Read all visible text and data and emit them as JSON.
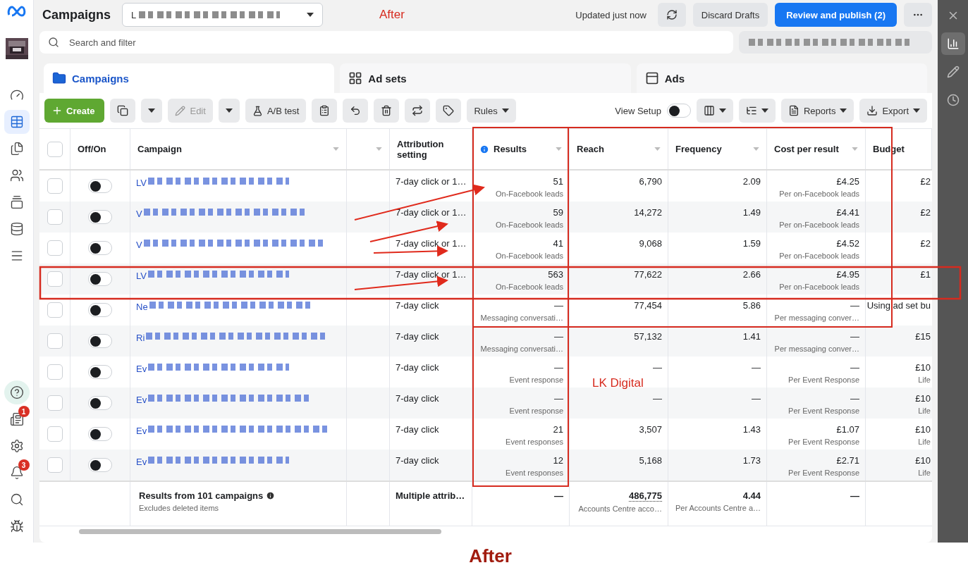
{
  "header": {
    "title": "Campaigns",
    "account_selector": {
      "value": "L"
    },
    "status": "Updated just now",
    "actions": [
      {
        "label": "Discard Drafts",
        "kind": "secondary"
      },
      {
        "label": "Review and publish (2)",
        "kind": "primary"
      }
    ]
  },
  "search": {
    "placeholder": "Search and filter"
  },
  "tabs": [
    {
      "label": "Campaigns",
      "kind": "campaigns",
      "selected": true
    },
    {
      "label": "Ad sets",
      "kind": "adsets",
      "selected": false
    },
    {
      "label": "Ads",
      "kind": "ads",
      "selected": false
    }
  ],
  "toolbar": {
    "create": "Create",
    "edit": {
      "label": "Edit",
      "disabled": true
    },
    "ab_test": "A/B test",
    "rules": "Rules",
    "view_setup": {
      "label": "View Setup",
      "on": false
    },
    "reports": "Reports",
    "export": "Export"
  },
  "sidebar": {
    "top": [
      {
        "kind": "dashboard",
        "selected": false
      },
      {
        "kind": "campaigns",
        "selected": true
      },
      {
        "kind": "pages",
        "selected": false
      },
      {
        "kind": "audiences",
        "selected": false
      },
      {
        "kind": "catalog",
        "selected": false
      },
      {
        "kind": "billing",
        "selected": false
      },
      {
        "kind": "menu",
        "selected": false
      }
    ],
    "bottom": [
      {
        "kind": "help",
        "selected": false
      },
      {
        "kind": "news",
        "selected": false,
        "badge": "1"
      },
      {
        "kind": "settings",
        "selected": false
      },
      {
        "kind": "notifications",
        "selected": false,
        "badge": "3"
      },
      {
        "kind": "search",
        "selected": false
      },
      {
        "kind": "debug",
        "selected": false
      }
    ]
  },
  "side_panel": [
    {
      "kind": "close",
      "selected": false
    },
    {
      "kind": "insights",
      "selected": true
    },
    {
      "kind": "edit",
      "selected": false
    },
    {
      "kind": "history",
      "selected": false
    }
  ],
  "table": {
    "select_all": {
      "checked": false
    },
    "columns": [
      {
        "label": "Off/On",
        "sortable": false,
        "info": false
      },
      {
        "label": "Campaign",
        "sortable": true,
        "info": false
      },
      {
        "label": "Attribution setting",
        "sortable": false,
        "info": false
      },
      {
        "label": "Results",
        "sortable": true,
        "info": true
      },
      {
        "label": "Reach",
        "sortable": true,
        "info": false
      },
      {
        "label": "Frequency",
        "sortable": true,
        "info": false
      },
      {
        "label": "Cost per result",
        "sortable": true,
        "info": false
      },
      {
        "label": "Budget",
        "sortable": false,
        "info": false
      }
    ],
    "rows": [
      {
        "checked": false,
        "on": false,
        "campaign": "LV",
        "attribution": "7-day click or 1…",
        "results": "51",
        "results_type": "On-Facebook leads",
        "reach": "6,790",
        "frequency": "2.09",
        "cost": "£4.25",
        "cost_type": "Per on-Facebook leads",
        "budget": "£2"
      },
      {
        "checked": false,
        "on": false,
        "campaign": "V",
        "attribution": "7-day click or 1…",
        "results": "59",
        "results_type": "On-Facebook leads",
        "reach": "14,272",
        "frequency": "1.49",
        "cost": "£4.41",
        "cost_type": "Per on-Facebook leads",
        "budget": "£2"
      },
      {
        "checked": false,
        "on": false,
        "campaign": "V",
        "attribution": "7-day click or 1…",
        "results": "41",
        "results_type": "On-Facebook leads",
        "reach": "9,068",
        "frequency": "1.59",
        "cost": "£4.52",
        "cost_type": "Per on-Facebook leads",
        "budget": "£2"
      },
      {
        "checked": false,
        "on": false,
        "campaign": "LV",
        "attribution": "7-day click or 1…",
        "results": "563",
        "results_type": "On-Facebook leads",
        "reach": "77,622",
        "frequency": "2.66",
        "cost": "£4.95",
        "cost_type": "Per on-Facebook leads",
        "budget": "£1"
      },
      {
        "checked": false,
        "on": false,
        "campaign": "Ne",
        "attribution": "7-day click",
        "results": "—",
        "results_type": "Messaging conversati…",
        "reach": "77,454",
        "frequency": "5.86",
        "cost": "—",
        "cost_type": "Per messaging conver…",
        "budget": "Using ad set bu"
      },
      {
        "checked": false,
        "on": false,
        "campaign": "Ri",
        "attribution": "7-day click",
        "results": "—",
        "results_type": "Messaging conversati…",
        "reach": "57,132",
        "frequency": "1.41",
        "cost": "—",
        "cost_type": "Per messaging conver…",
        "budget": "£15"
      },
      {
        "checked": false,
        "on": false,
        "campaign": "Ev",
        "attribution": "7-day click",
        "results": "—",
        "results_type": "Event response",
        "reach": "—",
        "frequency": "—",
        "cost": "—",
        "cost_type": "Per Event Response",
        "budget": "£10",
        "budget_note": "Life"
      },
      {
        "checked": false,
        "on": false,
        "campaign": "Ev",
        "attribution": "7-day click",
        "results": "—",
        "results_type": "Event response",
        "reach": "—",
        "frequency": "—",
        "cost": "—",
        "cost_type": "Per Event Response",
        "budget": "£10",
        "budget_note": "Life"
      },
      {
        "checked": false,
        "on": false,
        "campaign": "Ev",
        "attribution": "7-day click",
        "results": "21",
        "results_type": "Event responses",
        "reach": "3,507",
        "frequency": "1.43",
        "cost": "£1.07",
        "cost_type": "Per Event Response",
        "budget": "£10",
        "budget_note": "Life"
      },
      {
        "checked": false,
        "on": false,
        "campaign": "Ev",
        "attribution": "7-day click",
        "results": "12",
        "results_type": "Event responses",
        "reach": "5,168",
        "frequency": "1.73",
        "cost": "£2.71",
        "cost_type": "Per Event Response",
        "budget": "£10",
        "budget_note": "Life"
      }
    ],
    "footer": {
      "label": "Results from 101 campaigns",
      "note": "Excludes deleted items",
      "attribution": "Multiple attrib…",
      "results": "—",
      "reach": "486,775",
      "reach_note": "Accounts Centre acco…",
      "frequency": "4.44",
      "frequency_note": "Per Accounts Centre a…",
      "cost": "—"
    }
  },
  "annotations": {
    "top_label": "After",
    "mark_label": "LK Digital",
    "caption": "After"
  }
}
